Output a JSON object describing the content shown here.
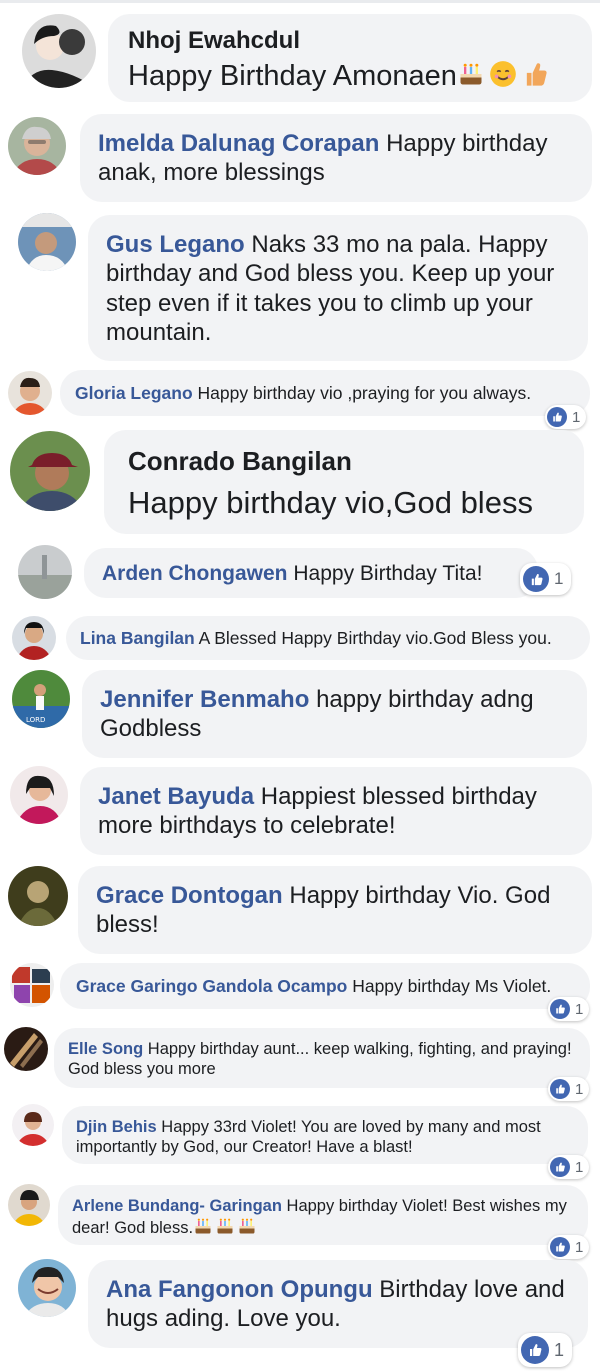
{
  "comments": [
    {
      "name": "Nhoj Ewahcdul",
      "text": "Happy Birthday Amonaen",
      "emojis": [
        "cake-icon",
        "smiling-face-icon",
        "thumbs-up-icon"
      ]
    },
    {
      "name": "Imelda Dalunag Corapan",
      "text": "Happy birthday anak, more blessings"
    },
    {
      "name": "Gus Legano",
      "text": "Naks 33 mo na pala. Happy birthday and God bless you. Keep up your step even if it takes you to climb up your mountain."
    },
    {
      "name": "Gloria Legano",
      "text": "Happy birthday vio ,praying for you always.",
      "reactions": "1"
    },
    {
      "name": "Conrado Bangilan",
      "text": "Happy birthday vio,God bless"
    },
    {
      "name": "Arden Chongawen",
      "text": "Happy Birthday Tita!",
      "reactions": "1"
    },
    {
      "name": "Lina Bangilan",
      "text": "A Blessed Happy Birthday vio.God Bless you."
    },
    {
      "name": "Jennifer Benmaho",
      "text": "happy birthday adng Godbless"
    },
    {
      "name": "Janet Bayuda",
      "text": "Happiest blessed birthday more birthdays to celebrate!"
    },
    {
      "name": "Grace Dontogan",
      "text": "Happy birthday Vio. God bless!"
    },
    {
      "name": "Grace Garingo Gandola Ocampo",
      "text": "Happy birthday Ms Violet.",
      "reactions": "1"
    },
    {
      "name": "Elle Song",
      "text": "Happy birthday aunt... keep walking, fighting, and praying! God bless you more",
      "reactions": "1"
    },
    {
      "name": "Djin Behis",
      "text": "Happy 33rd Violet! You are loved by many and most importantly by God, our Creator! Have a blast!",
      "reactions": "1"
    },
    {
      "name": "Arlene Bundang- Garingan",
      "text": "Happy birthday Violet! Best wishes my dear! God bless.",
      "emojis": [
        "cake-icon",
        "cake-icon",
        "cake-icon"
      ],
      "reactions": "1"
    },
    {
      "name": "Ana Fangonon Opungu",
      "text": "Birthday love and hugs ading. Love you.",
      "reactions": "1"
    }
  ],
  "colors": {
    "name": "#385898",
    "bubble": "#f2f3f5",
    "like": "#4267b2"
  }
}
